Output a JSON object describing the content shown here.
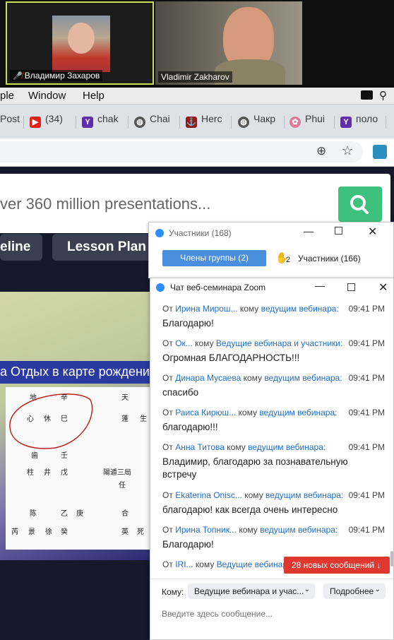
{
  "videos": {
    "participant1_name": "Владимир Захаров",
    "participant2_name": "Vladimir Zakharov"
  },
  "menubar": {
    "items": [
      "ple",
      "Window",
      "Help"
    ]
  },
  "browser": {
    "tabs": [
      {
        "label": "Post",
        "icon": "generic-icon"
      },
      {
        "label": "(34)",
        "icon": "youtube-icon"
      },
      {
        "label": "chak",
        "icon": "yahoo-icon"
      },
      {
        "label": "Chai",
        "icon": "globe-icon"
      },
      {
        "label": "Herc",
        "icon": "ship-icon"
      },
      {
        "label": "Чакр",
        "icon": "globe-icon"
      },
      {
        "label": "Phui",
        "icon": "brain-icon"
      },
      {
        "label": "поло",
        "icon": "yahoo-icon"
      }
    ]
  },
  "page": {
    "search_placeholder": "ver 360 million presentations...",
    "nav": [
      "eline",
      "Lesson Plan"
    ],
    "slide_title": "а Отдых в карте рождени"
  },
  "participants_panel": {
    "title": "Участники (168)",
    "tab_members": "Члены группы (2)",
    "raised_hands": "2",
    "tab_participants": "Участники (166)"
  },
  "chat": {
    "title": "Чат веб-семинара Zoom",
    "from_word": "От",
    "to_word": "кому",
    "messages": [
      {
        "from": "Ирина Мирош...",
        "to": "ведущим вебинара:",
        "time": "09:41 PM",
        "text": "Благодарю!"
      },
      {
        "from": "Ок...",
        "to": "Ведущие вебинара и участники:",
        "time": "09:41 PM",
        "text": "Огромная БЛАГОДАРНОСТЬ!!!"
      },
      {
        "from": "Динара Мусаева",
        "to": "ведущим вебинара:",
        "time": "09:41 PM",
        "text": "спасибо"
      },
      {
        "from": "Раиса Кирюш...",
        "to": "ведущим вебинара:",
        "time": "09:41 PM",
        "text": "благодарю!!!"
      },
      {
        "from": "Анна Титова",
        "to": "ведущим вебинара:",
        "time": "09:41 PM",
        "text": "Владимир, благодарю за познавательную встречу"
      },
      {
        "from": "Ekaterina Onisc...",
        "to": "ведущим вебинара:",
        "time": "09:41 PM",
        "text": "благодарю!  как всегда очень интересно"
      },
      {
        "from": "Ирина Топник...",
        "to": "ведущим вебинара:",
        "time": "09:41 PM",
        "text": "Благодарю!"
      },
      {
        "from": "IRI...",
        "to": "Ведущие вебинар",
        "time": "",
        "text": ""
      }
    ],
    "new_messages": "28 новых сообщений ↓",
    "to_label": "Кому:",
    "to_value": "Ведущие вебинара и учас...",
    "more_label": "Подробнее",
    "input_placeholder": "Введите здесь сообщение..."
  },
  "colors": {
    "accent": "#1e6ec8",
    "zoom_blue": "#2d8cff",
    "alert_red": "#e0372f",
    "search_green": "#3ec07f"
  }
}
